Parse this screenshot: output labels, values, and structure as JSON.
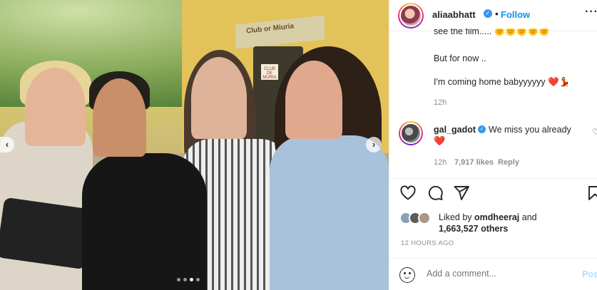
{
  "post": {
    "author": "aliaabhatt",
    "follow_label": "Follow",
    "separator": "•",
    "more_label": "···",
    "verified_mark": "✓"
  },
  "media": {
    "sign_text": "Club or Miuria",
    "sign2_text": "CLUB DE MURIA",
    "carousel_count": 4,
    "carousel_active_index": 2
  },
  "caption": {
    "line_partial": "see the film..... 🌞🌞🌞🌞🌞",
    "line2": "But for now ..",
    "line3": "I'm coming home babyyyyyy",
    "line3_emojis": "❤️💃",
    "time": "12h"
  },
  "comment": {
    "user": "gal_gadot",
    "text": "We miss you already",
    "emoji": "❤️",
    "time": "12h",
    "likes": "7,917 likes",
    "reply_label": "Reply"
  },
  "actions": {
    "icons": [
      "heart-icon",
      "comment-icon",
      "share-icon",
      "bookmark-icon"
    ]
  },
  "likes": {
    "liked_by_prefix": "Liked by",
    "liked_by_user": "omdheeraj",
    "and": "and",
    "others_count": "1,663,527 others"
  },
  "timestamp": "12 HOURS AGO",
  "comment_box": {
    "placeholder": "Add a comment...",
    "post_label": "Post"
  }
}
